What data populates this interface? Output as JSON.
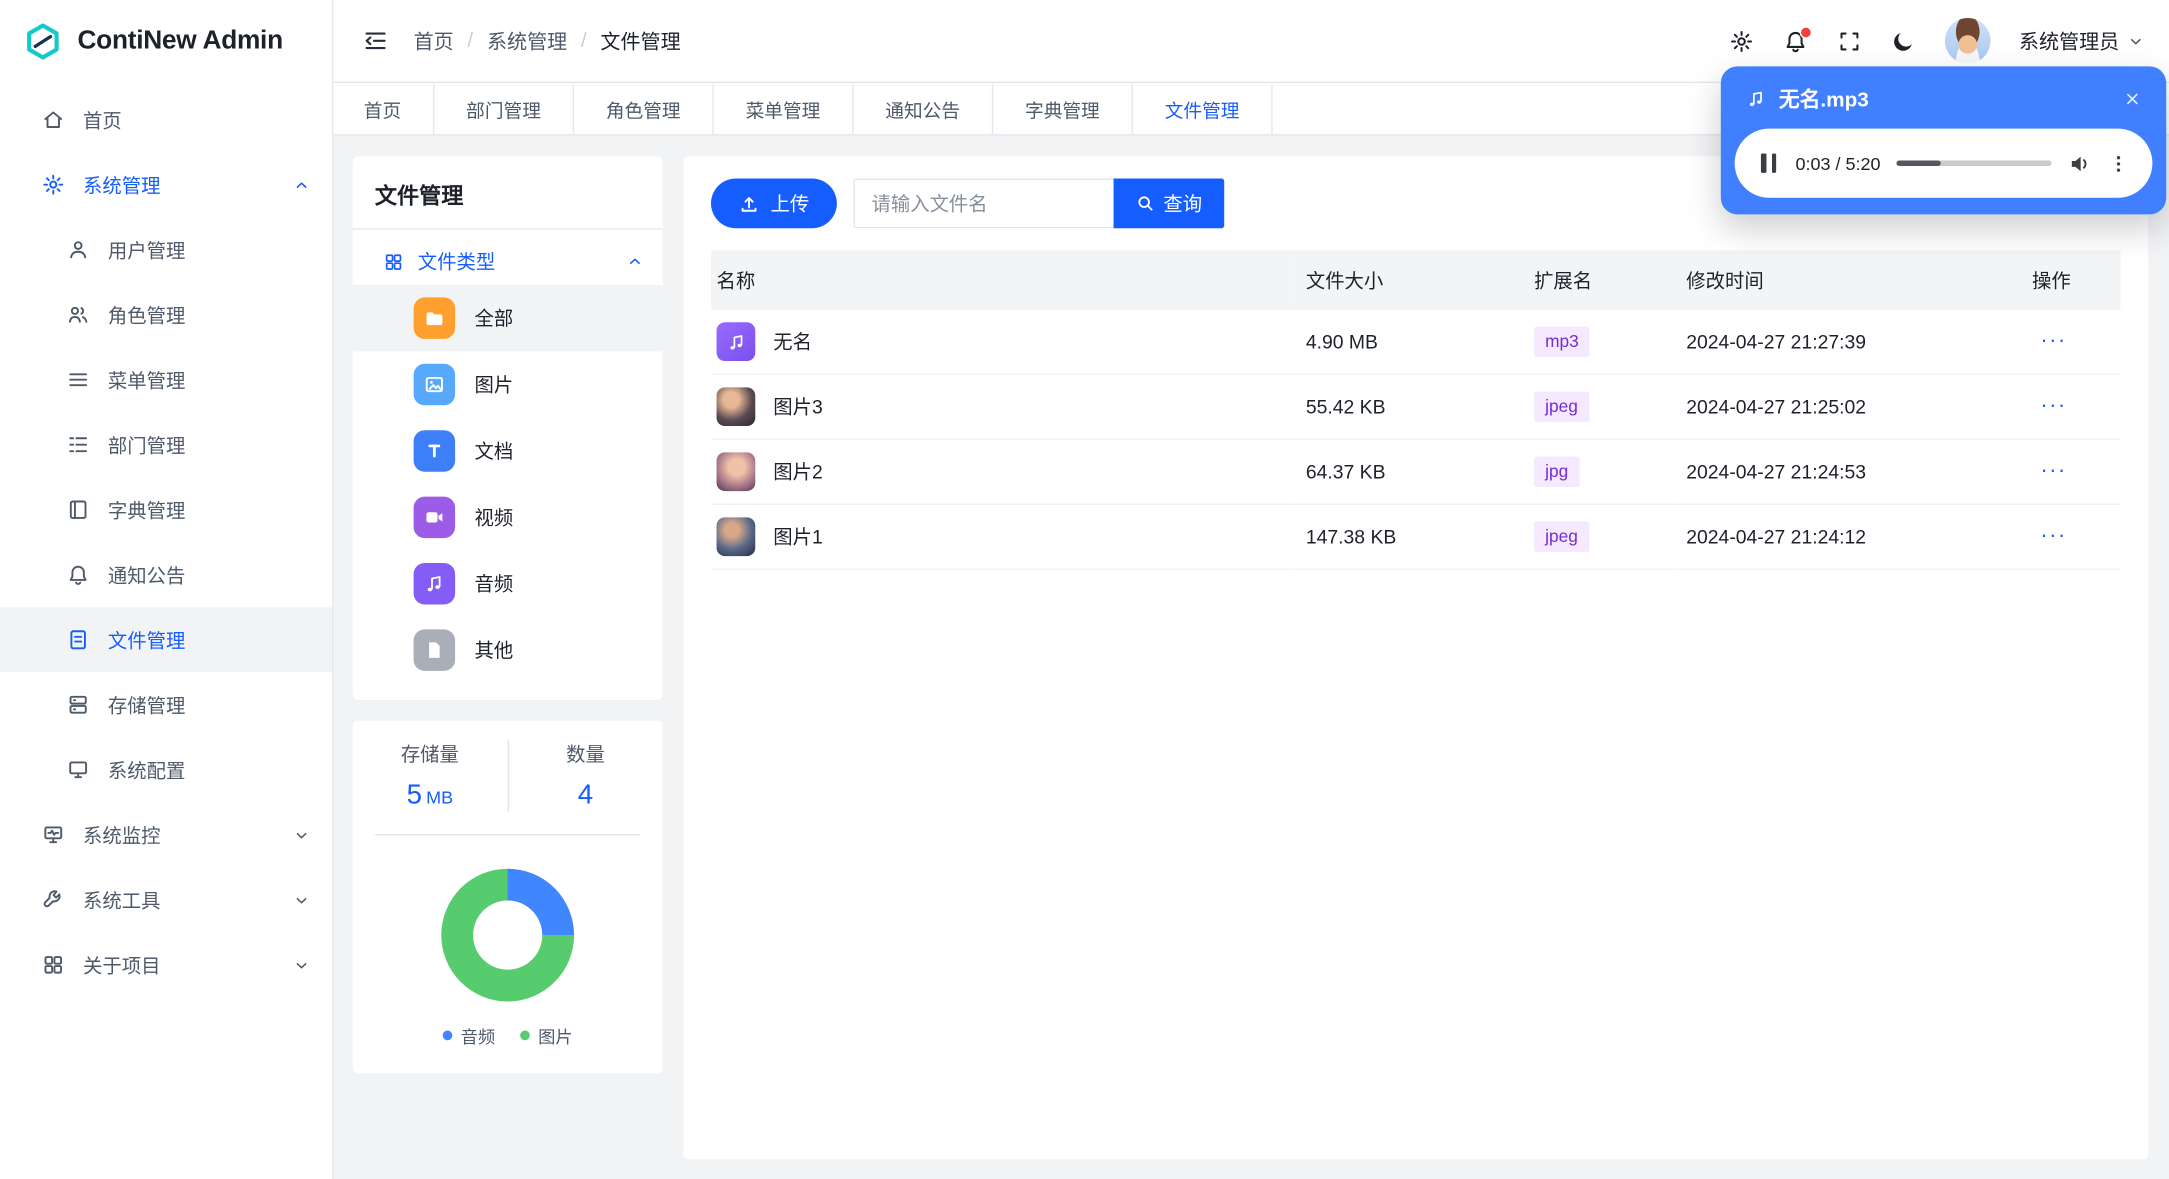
{
  "app": {
    "name": "ContiNew Admin",
    "primary_color": "#165dff"
  },
  "topbar": {
    "breadcrumb": [
      "首页",
      "系统管理",
      "文件管理"
    ],
    "breadcrumb_separator": "/",
    "user_name": "系统管理员"
  },
  "tabs": [
    "首页",
    "部门管理",
    "角色管理",
    "菜单管理",
    "通知公告",
    "字典管理",
    "文件管理"
  ],
  "active_tab": "文件管理",
  "sidebar": {
    "items": [
      {
        "label": "首页"
      },
      {
        "label": "系统管理",
        "expanded": true,
        "children": [
          "用户管理",
          "角色管理",
          "菜单管理",
          "部门管理",
          "字典管理",
          "通知公告",
          "文件管理",
          "存储管理",
          "系统配置"
        ],
        "active_child": "文件管理"
      },
      {
        "label": "系统监控"
      },
      {
        "label": "系统工具"
      },
      {
        "label": "关于项目"
      }
    ]
  },
  "file_panel": {
    "title": "文件管理",
    "tree_title": "文件类型",
    "types": [
      {
        "label": "全部",
        "color": "#ffa02e",
        "selected": true
      },
      {
        "label": "图片",
        "color": "#57a9fb"
      },
      {
        "label": "文档",
        "color": "#3d7ff6"
      },
      {
        "label": "视频",
        "color": "#9c5ce8"
      },
      {
        "label": "音频",
        "color": "#845cf6"
      },
      {
        "label": "其他",
        "color": "#a9aeb8"
      }
    ]
  },
  "stats": {
    "storage_label": "存储量",
    "storage_value": "5",
    "storage_unit": "MB",
    "count_label": "数量",
    "count_value": "4"
  },
  "chart_data": {
    "type": "pie",
    "donut": true,
    "categories": [
      "音频",
      "图片"
    ],
    "values": [
      1,
      3
    ],
    "colors": [
      "#4086ff",
      "#57cc6e"
    ],
    "legend_position": "bottom"
  },
  "toolbar": {
    "upload_label": "上传",
    "search_placeholder": "请输入文件名",
    "search_label": "查询"
  },
  "table": {
    "headers": [
      "名称",
      "文件大小",
      "扩展名",
      "修改时间",
      "操作"
    ],
    "actions_label": "···",
    "rows": [
      {
        "name": "无名",
        "size": "4.90 MB",
        "ext": "mp3",
        "modified": "2024-04-27 21:27:39"
      },
      {
        "name": "图片3",
        "size": "55.42 KB",
        "ext": "jpeg",
        "modified": "2024-04-27 21:25:02"
      },
      {
        "name": "图片2",
        "size": "64.37 KB",
        "ext": "jpg",
        "modified": "2024-04-27 21:24:53"
      },
      {
        "name": "图片1",
        "size": "147.38 KB",
        "ext": "jpeg",
        "modified": "2024-04-27 21:24:12"
      }
    ]
  },
  "player": {
    "title": "无名.mp3",
    "time": "0:03 / 5:20",
    "progress_percent": 28
  }
}
